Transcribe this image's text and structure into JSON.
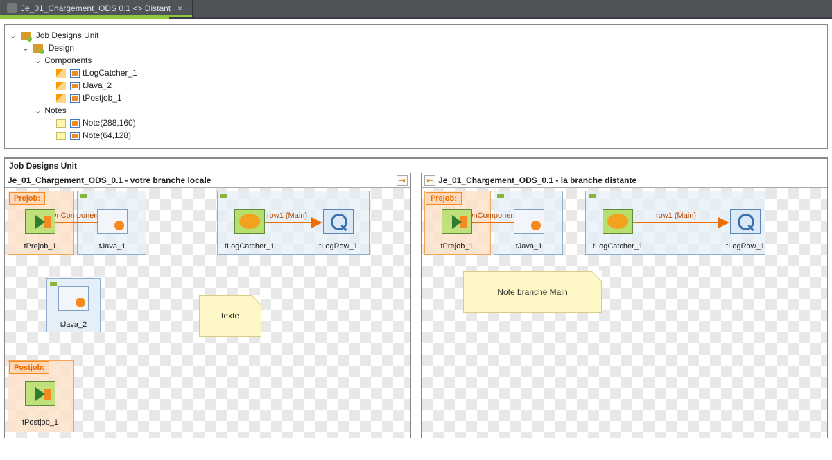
{
  "tab": {
    "title": "Je_01_Chargement_ODS 0.1 <> Distant",
    "close": "×"
  },
  "outline": {
    "root": "Job Designs Unit",
    "design": "Design",
    "components_label": "Components",
    "components": {
      "c0": "tLogCatcher_1",
      "c1": "tJava_2",
      "c2": "tPostjob_1"
    },
    "notes_label": "Notes",
    "notes": {
      "n0": "Note(288,160)",
      "n1": "Note(64,128)"
    }
  },
  "panel_header": "Job Designs Unit",
  "local": {
    "title": "Je_01_Chargement_ODS_0.1 - votre branche locale",
    "prejob_pill": "Prejob:",
    "postjob_pill": "Postjob:",
    "nodes": {
      "tprejob": "tPrejob_1",
      "tjava": "tJava_1",
      "tlogcatcher": "tLogCatcher_1",
      "tlogrow": "tLogRow_1",
      "tjava2": "tJava_2",
      "tpostjob": "tPostjob_1"
    },
    "links": {
      "oncomp": "OnComponentOk",
      "row1": "row1 (Main)"
    },
    "note_text": "texte"
  },
  "remote": {
    "title": "Je_01_Chargement_ODS_0.1 - la branche distante",
    "prejob_pill": "Prejob:",
    "nodes": {
      "tprejob": "tPrejob_1",
      "tjava": "tJava_1",
      "tlogcatcher": "tLogCatcher_1",
      "tlogrow": "tLogRow_1"
    },
    "links": {
      "oncomp": "OnComponentOk",
      "row1": "row1 (Main)"
    },
    "note_text": "Note branche Main"
  }
}
